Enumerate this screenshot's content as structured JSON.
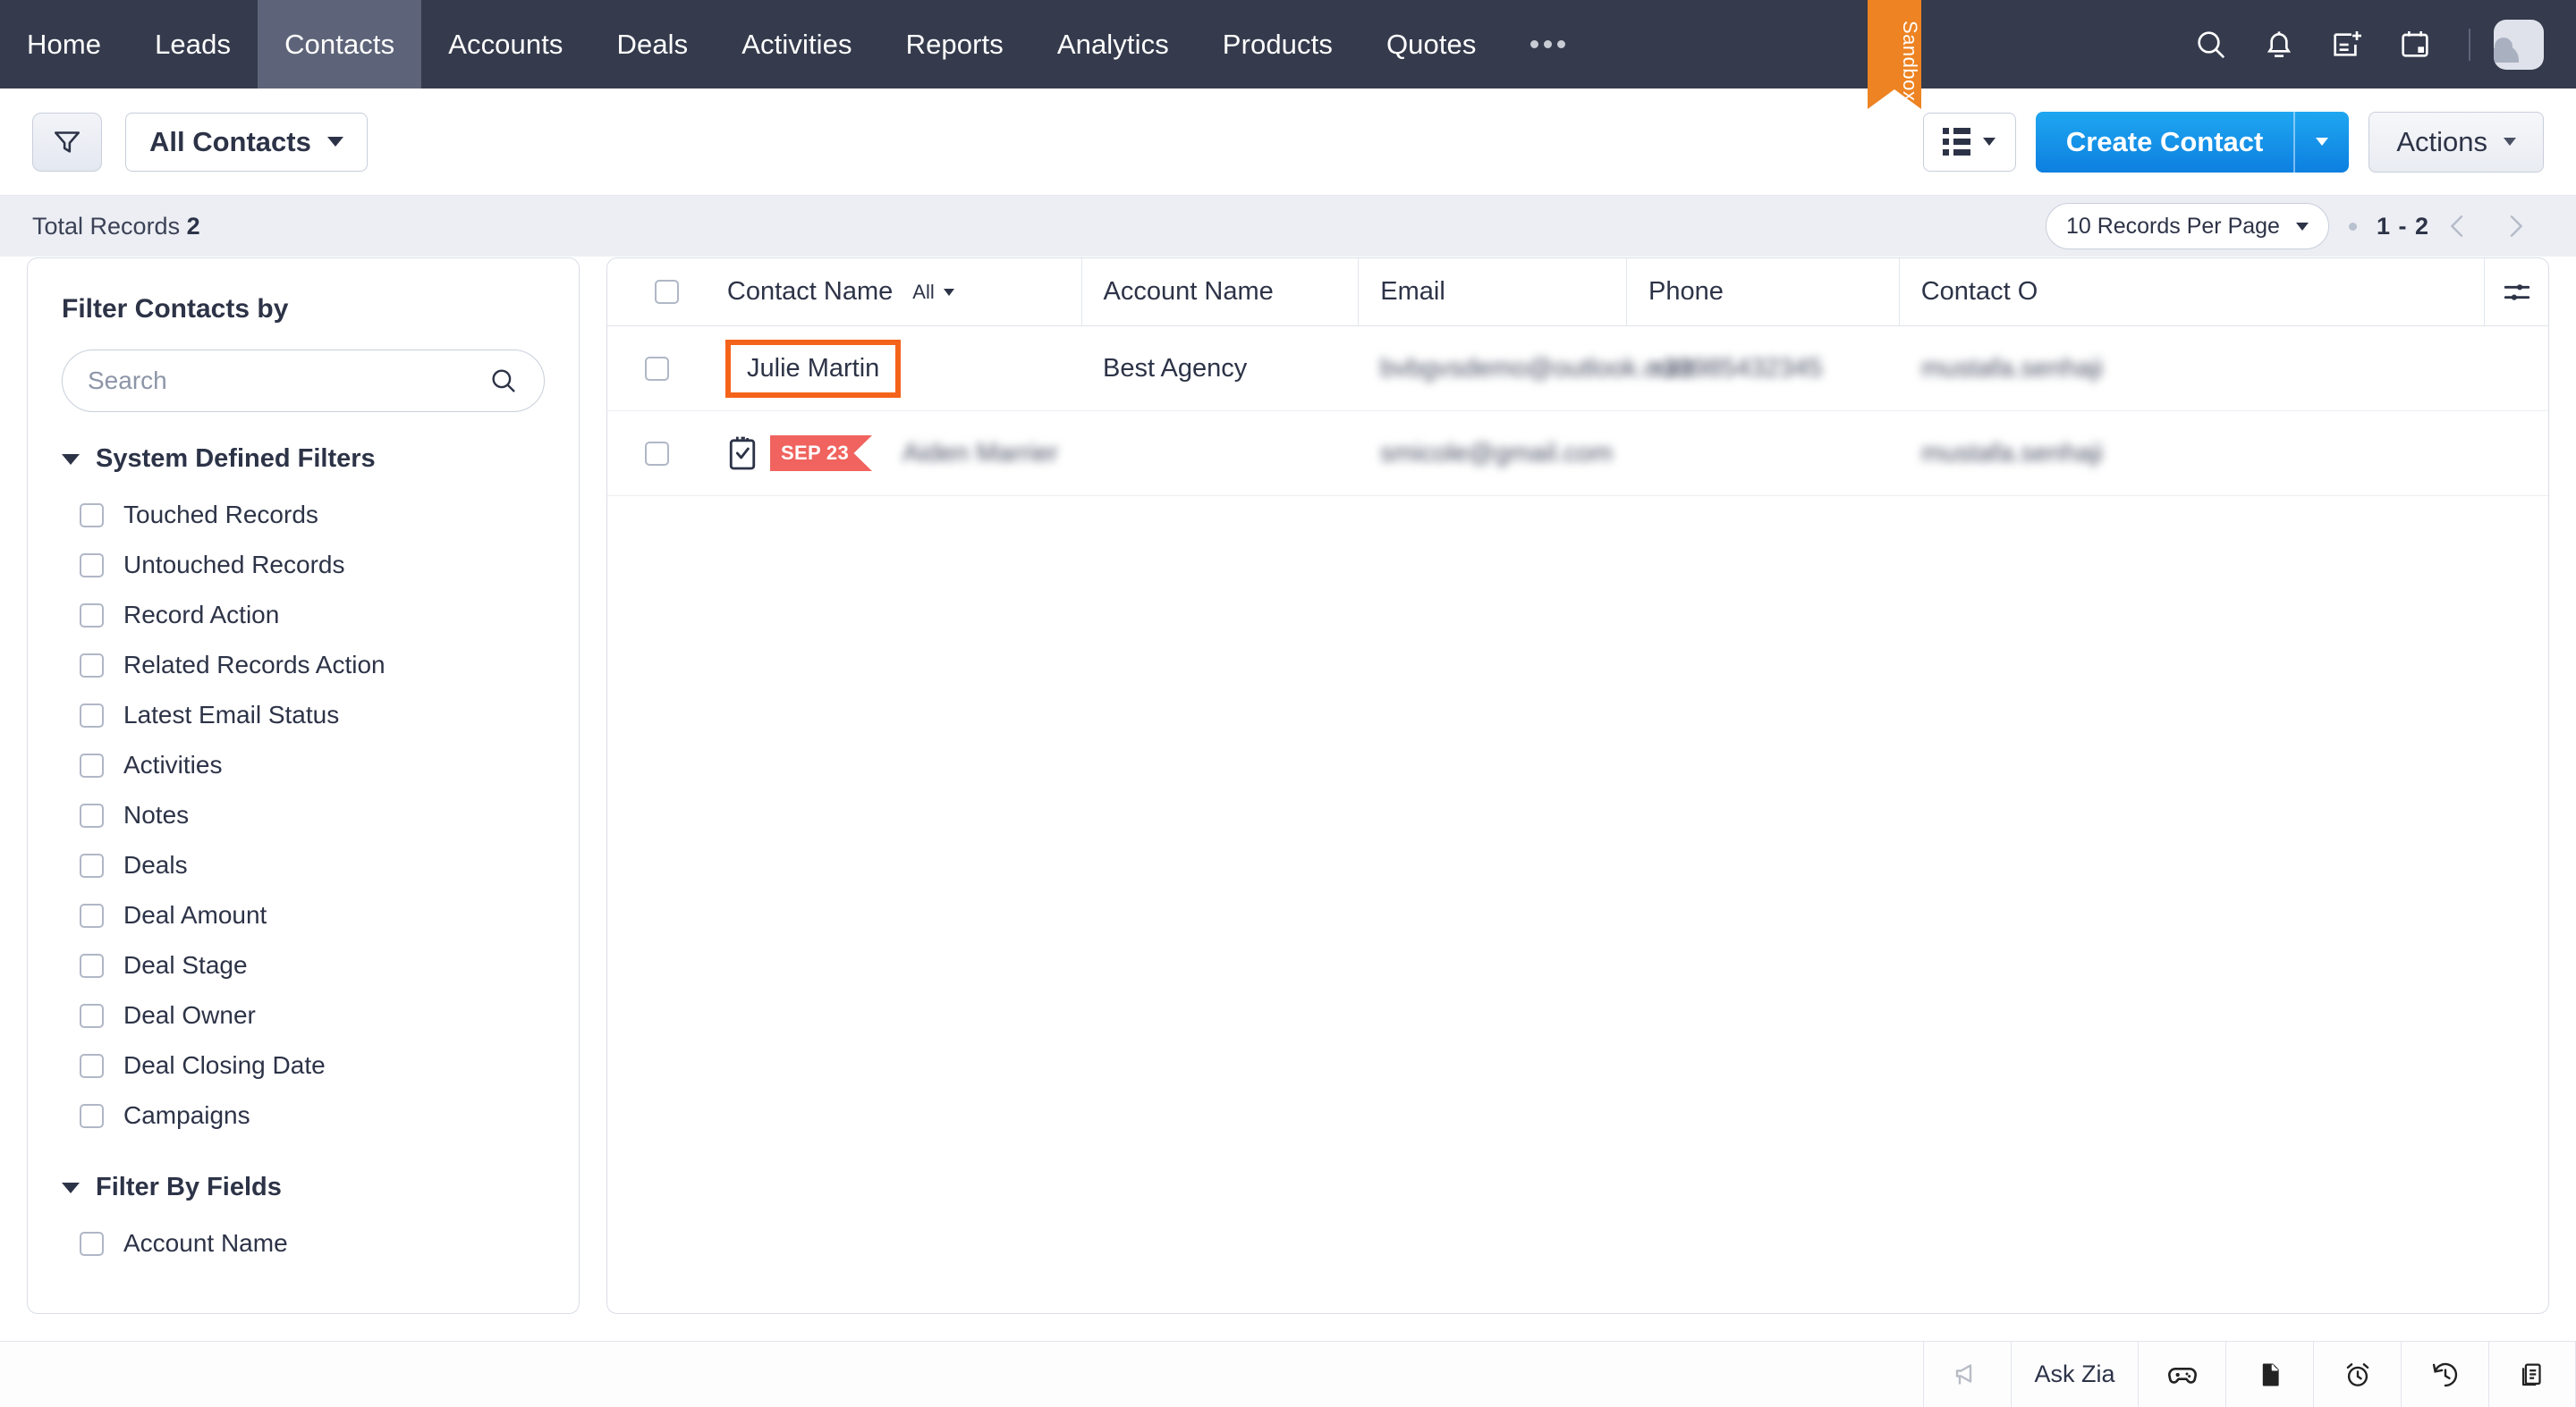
{
  "topnav": {
    "items": [
      {
        "label": "Home",
        "active": false
      },
      {
        "label": "Leads",
        "active": false
      },
      {
        "label": "Contacts",
        "active": true
      },
      {
        "label": "Accounts",
        "active": false
      },
      {
        "label": "Deals",
        "active": false
      },
      {
        "label": "Activities",
        "active": false
      },
      {
        "label": "Reports",
        "active": false
      },
      {
        "label": "Analytics",
        "active": false
      },
      {
        "label": "Products",
        "active": false
      },
      {
        "label": "Quotes",
        "active": false
      }
    ],
    "more_label": "•••",
    "icons": [
      "search-icon",
      "bell-icon",
      "add-record-icon",
      "calendar-icon"
    ],
    "background": "#353b4d",
    "active_background": "#5d6479"
  },
  "sandbox": {
    "label": "Sandbox",
    "color": "#ed8322"
  },
  "toolbar": {
    "filter_icon": "funnel-icon",
    "view_selector": "All Contacts",
    "view_mode_icon": "list-view-icon",
    "create_label": "Create Contact",
    "create_color": "#0d7fe0",
    "actions_label": "Actions"
  },
  "recordsbar": {
    "total_label": "Total Records",
    "total_count": "2",
    "per_page": "10 Records Per Page",
    "page_range": "1 - 2",
    "prev_icon": "chevron-left-icon",
    "next_icon": "chevron-right-icon"
  },
  "sidebar": {
    "title": "Filter Contacts by",
    "search_placeholder": "Search",
    "search_value": "",
    "groups": [
      {
        "title": "System Defined Filters",
        "items": [
          {
            "label": "Touched Records",
            "checked": false
          },
          {
            "label": "Untouched Records",
            "checked": false
          },
          {
            "label": "Record Action",
            "checked": false
          },
          {
            "label": "Related Records Action",
            "checked": false
          },
          {
            "label": "Latest Email Status",
            "checked": false
          },
          {
            "label": "Activities",
            "checked": false
          },
          {
            "label": "Notes",
            "checked": false
          },
          {
            "label": "Deals",
            "checked": false
          },
          {
            "label": "Deal Amount",
            "checked": false
          },
          {
            "label": "Deal Stage",
            "checked": false
          },
          {
            "label": "Deal Owner",
            "checked": false
          },
          {
            "label": "Deal Closing Date",
            "checked": false
          },
          {
            "label": "Campaigns",
            "checked": false
          }
        ]
      },
      {
        "title": "Filter By Fields",
        "items": [
          {
            "label": "Account Name",
            "checked": false
          }
        ]
      }
    ]
  },
  "table": {
    "columns": [
      {
        "label": "Contact Name",
        "filter": "All"
      },
      {
        "label": "Account Name"
      },
      {
        "label": "Email"
      },
      {
        "label": "Phone"
      },
      {
        "label": "Contact O"
      }
    ],
    "settings_icon": "column-settings-icon",
    "rows": [
      {
        "name": "Julie Martin",
        "highlighted": true,
        "account": "Best Agency",
        "email": "bvbgvsdemo@outlook.com",
        "email_blurred": true,
        "phone": "+33985432345",
        "phone_blurred": true,
        "owner": "mustafa.senhaji",
        "owner_blurred": true,
        "badge": null
      },
      {
        "name": "Aiden Marrier",
        "name_blurred": true,
        "highlighted": false,
        "account": "",
        "email": "smicole@gmail.com",
        "email_blurred": true,
        "phone": "",
        "owner": "mustafa.senhaji",
        "owner_blurred": true,
        "badge": {
          "label": "SEP 23",
          "color": "#f0635e",
          "icon": "task-checklist-icon"
        }
      }
    ]
  },
  "bottombar": {
    "items": [
      {
        "icon": "megaphone-icon",
        "label": ""
      },
      {
        "icon": "",
        "label": "Ask Zia"
      },
      {
        "icon": "gamepad-icon",
        "label": ""
      },
      {
        "icon": "note-icon",
        "label": ""
      },
      {
        "icon": "alarm-clock-icon",
        "label": ""
      },
      {
        "icon": "history-icon",
        "label": ""
      },
      {
        "icon": "notes-stack-icon",
        "label": ""
      }
    ]
  }
}
